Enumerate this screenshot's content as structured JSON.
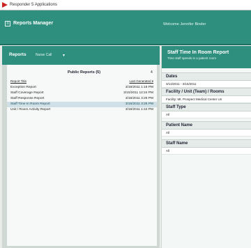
{
  "window": {
    "title": "Responder 5 Applications"
  },
  "header": {
    "menu_glyph": "≡",
    "title": "Reports Manager",
    "welcome": "Welcome Jennifer Binder"
  },
  "reports_panel": {
    "label": "Reports",
    "filter_text": "Nurse Call",
    "dropdown_glyph": "▾",
    "table_title": "Public Reports (5)",
    "count": "4",
    "columns": {
      "report_title": "Report Title",
      "last_generated": "Last Generated ▾"
    },
    "rows": [
      {
        "title": "Exception Report",
        "date": "3/16/2011 1:16 PM"
      },
      {
        "title": "Staff Coverage Report",
        "date": "3/10/2011 12:24 PM"
      },
      {
        "title": "Staff Response Report",
        "date": "3/16/2011 3:26 PM"
      },
      {
        "title": "Staff Time In Room Report",
        "date": "3/15/2011 3:26 PM"
      },
      {
        "title": "Unit / Room Activity Report",
        "date": "3/16/2011 1:44 PM"
      }
    ],
    "selected_row_index": 3
  },
  "details": {
    "heading": "Staff Time In Room Report",
    "subheading": "Time staff spends in a patient room",
    "sections": [
      {
        "label": "Dates",
        "value": "3/14/2011 - 3/15/2011"
      },
      {
        "label": "Facility / Unit (Team) / Rooms",
        "value": "Facility: Mt. Prospect Medical Center   Un"
      },
      {
        "label": "Staff Type",
        "value": "All"
      },
      {
        "label": "Patient Name",
        "value": "All"
      },
      {
        "label": "Staff Name",
        "value": "All"
      }
    ]
  }
}
